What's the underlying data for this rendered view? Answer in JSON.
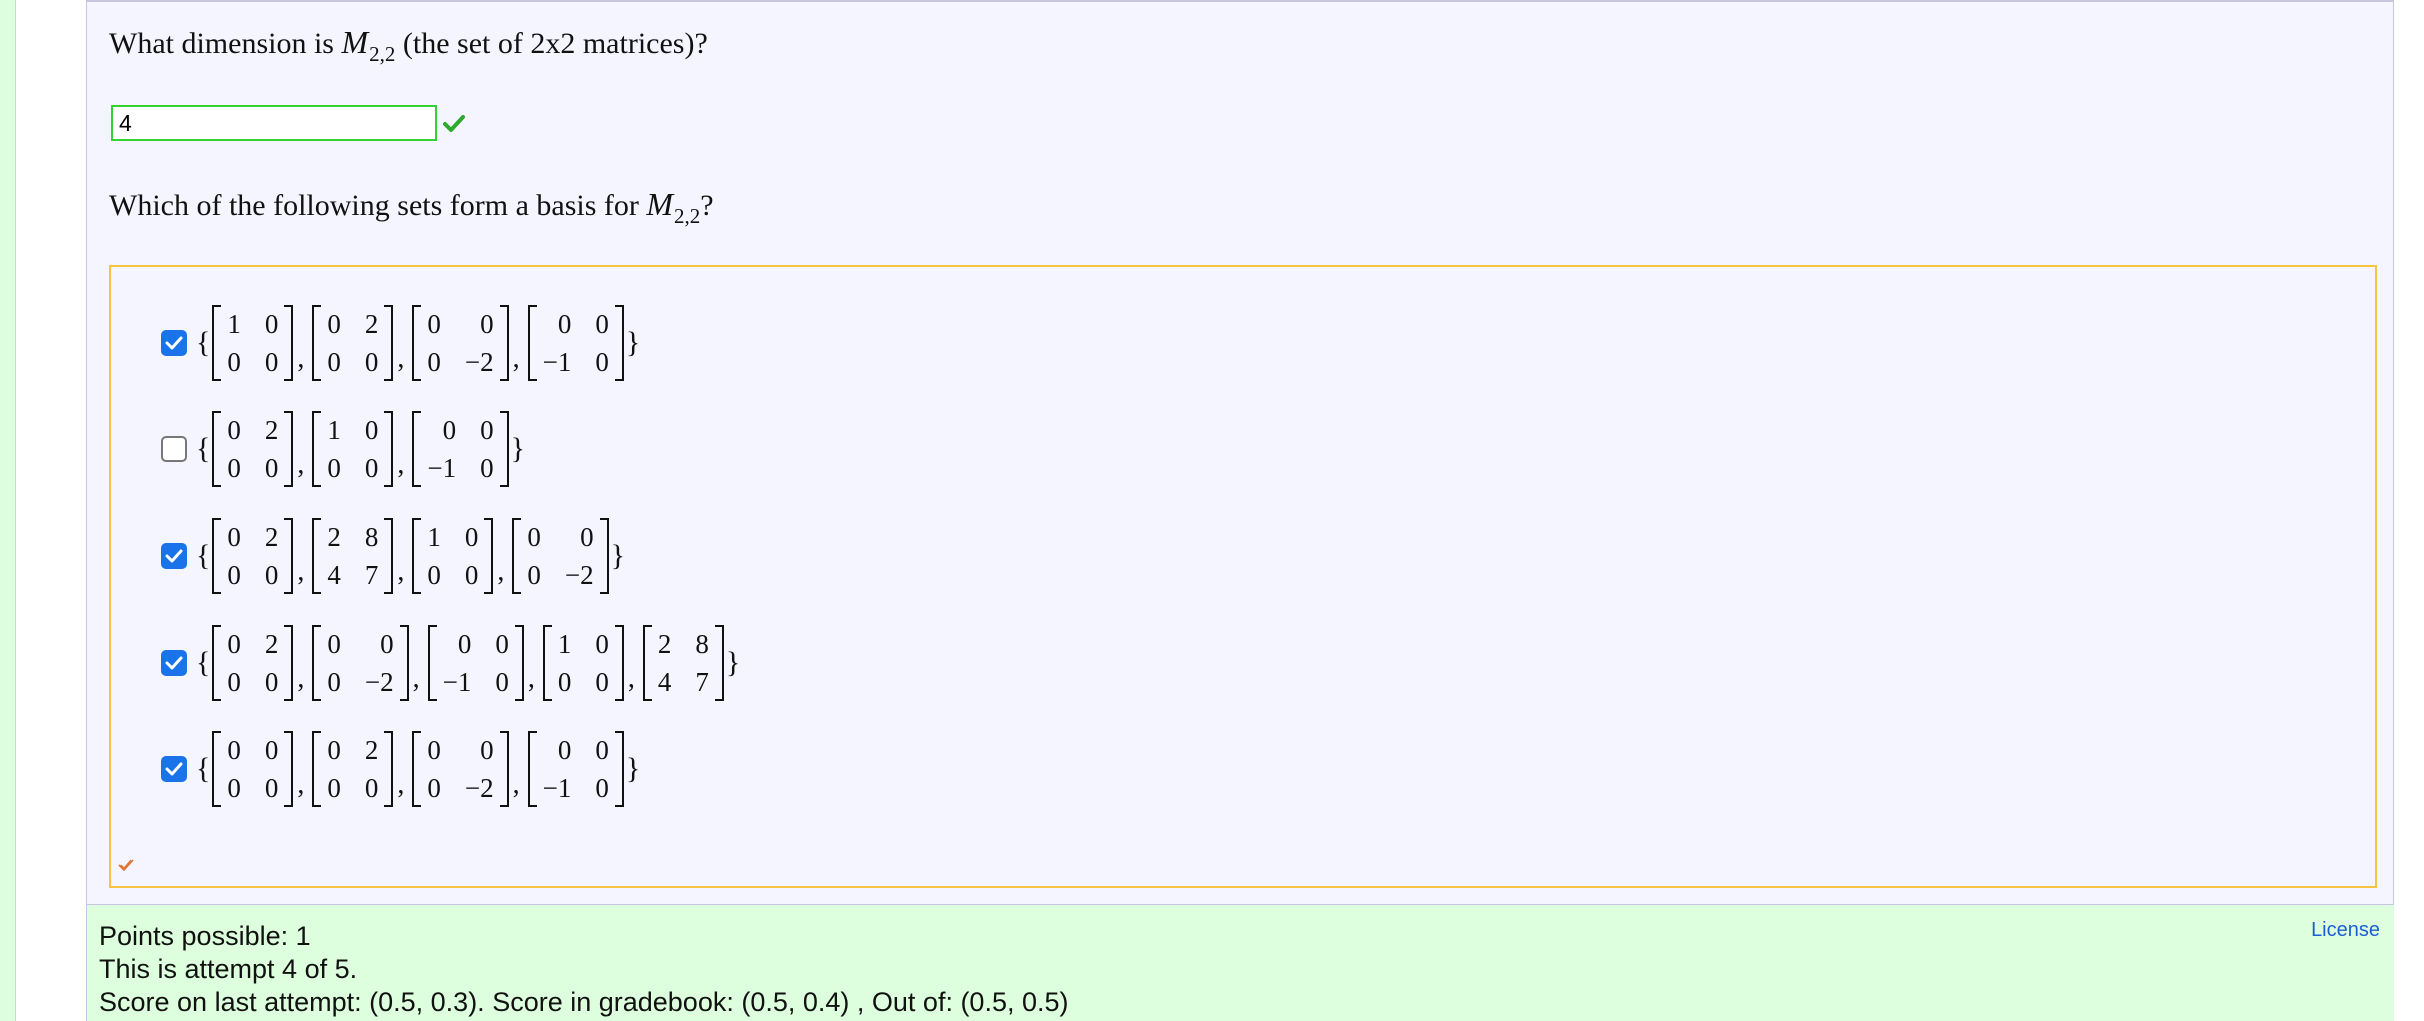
{
  "questions": {
    "dimension": {
      "text_before": "What dimension is ",
      "symbol": "M",
      "subscript": "2,2",
      "text_after": " (the set of 2x2 matrices)?"
    },
    "basis": {
      "text_before": "Which of the following sets form a basis for ",
      "symbol": "M",
      "subscript": "2,2",
      "text_after": "?"
    }
  },
  "answer_input": {
    "value": "4",
    "status": "correct"
  },
  "choices": [
    {
      "checked": true,
      "matrices": [
        [
          [
            "1",
            "0"
          ],
          [
            "0",
            "0"
          ]
        ],
        [
          [
            "0",
            "2"
          ],
          [
            "0",
            "0"
          ]
        ],
        [
          [
            "0",
            "0"
          ],
          [
            "0",
            "−2"
          ]
        ],
        [
          [
            "0",
            "0"
          ],
          [
            "−1",
            "0"
          ]
        ]
      ]
    },
    {
      "checked": false,
      "matrices": [
        [
          [
            "0",
            "2"
          ],
          [
            "0",
            "0"
          ]
        ],
        [
          [
            "1",
            "0"
          ],
          [
            "0",
            "0"
          ]
        ],
        [
          [
            "0",
            "0"
          ],
          [
            "−1",
            "0"
          ]
        ]
      ]
    },
    {
      "checked": true,
      "matrices": [
        [
          [
            "0",
            "2"
          ],
          [
            "0",
            "0"
          ]
        ],
        [
          [
            "2",
            "8"
          ],
          [
            "4",
            "7"
          ]
        ],
        [
          [
            "1",
            "0"
          ],
          [
            "0",
            "0"
          ]
        ],
        [
          [
            "0",
            "0"
          ],
          [
            "0",
            "−2"
          ]
        ]
      ]
    },
    {
      "checked": true,
      "matrices": [
        [
          [
            "0",
            "2"
          ],
          [
            "0",
            "0"
          ]
        ],
        [
          [
            "0",
            "0"
          ],
          [
            "0",
            "−2"
          ]
        ],
        [
          [
            "0",
            "0"
          ],
          [
            "−1",
            "0"
          ]
        ],
        [
          [
            "1",
            "0"
          ],
          [
            "0",
            "0"
          ]
        ],
        [
          [
            "2",
            "8"
          ],
          [
            "4",
            "7"
          ]
        ]
      ]
    },
    {
      "checked": true,
      "matrices": [
        [
          [
            "0",
            "0"
          ],
          [
            "0",
            "0"
          ]
        ],
        [
          [
            "0",
            "2"
          ],
          [
            "0",
            "0"
          ]
        ],
        [
          [
            "0",
            "0"
          ],
          [
            "0",
            "−2"
          ]
        ],
        [
          [
            "0",
            "0"
          ],
          [
            "−1",
            "0"
          ]
        ]
      ]
    }
  ],
  "footer": {
    "points": "Points possible: 1",
    "attempt": "This is attempt 4 of 5.",
    "score": "Score on last attempt: (0.5, 0.3). Score in gradebook: (0.5, 0.4) , Out of: (0.5, 0.5)",
    "license": "License"
  },
  "colors": {
    "correct": "#2eaa2e",
    "partial": "#e07030",
    "checkbox": "#1a73e8",
    "choices_border": "#f6c342",
    "footer_bg": "#ddffdd"
  },
  "icons": {
    "answer_status": "check-icon",
    "choices_status": "check-outline-icon"
  }
}
